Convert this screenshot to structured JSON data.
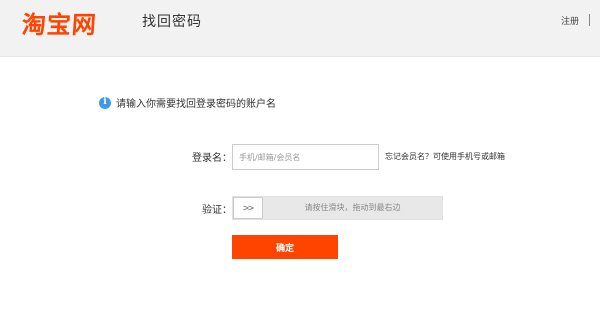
{
  "header": {
    "logo_text": "淘宝网",
    "page_title": "找回密码",
    "register_label": "注册"
  },
  "hint": {
    "icon": "info-icon",
    "text": "请输入你需要找回登录密码的账户名"
  },
  "form": {
    "account_label": "登录名：",
    "account_placeholder": "手机/邮箱/会员名",
    "account_value": "",
    "forgot_text": "忘记会员名？可使用手机号或邮箱",
    "verify_label": "验证：",
    "slider_handle_glyph": ">>",
    "slider_text": "请按住滑块，拖动到最右边",
    "confirm_label": "确定"
  },
  "colors": {
    "brand": "#ff4400",
    "info": "#3e9ae6",
    "header_bg": "#f2f2f2"
  }
}
